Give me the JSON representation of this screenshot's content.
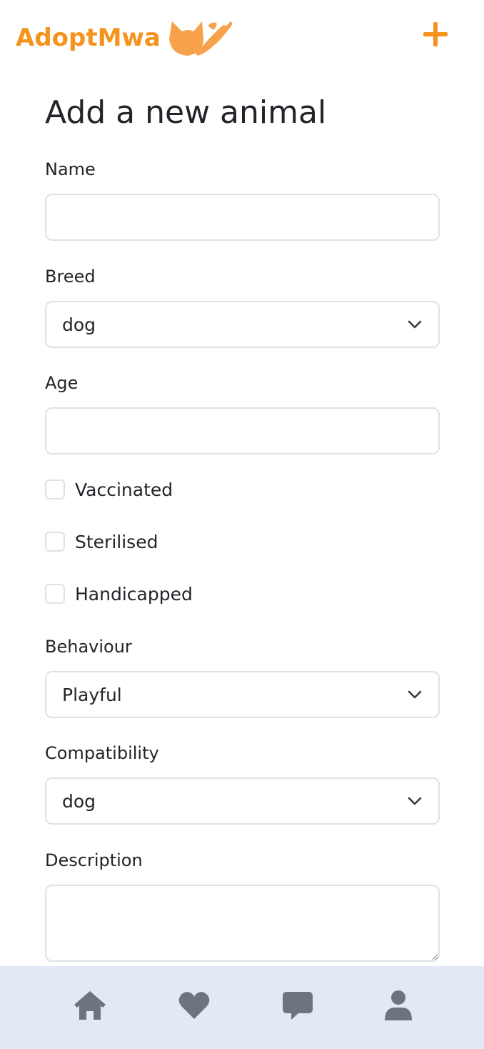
{
  "app": {
    "brand": "AdoptMwa",
    "colors": {
      "brand": "#f5941d",
      "nav_background": "#e2e9f4",
      "nav_icon": "#6c757d",
      "border": "#dee2e6"
    }
  },
  "header": {
    "add_icon": "plus-icon"
  },
  "form": {
    "title": "Add a new animal",
    "name": {
      "label": "Name",
      "value": "",
      "placeholder": ""
    },
    "breed": {
      "label": "Breed",
      "value": "dog"
    },
    "age": {
      "label": "Age",
      "value": "",
      "placeholder": ""
    },
    "checkboxes": [
      {
        "label": "Vaccinated",
        "checked": false
      },
      {
        "label": "Sterilised",
        "checked": false
      },
      {
        "label": "Handicapped",
        "checked": false
      }
    ],
    "behaviour": {
      "label": "Behaviour",
      "value": "Playful"
    },
    "compatibility": {
      "label": "Compatibility",
      "value": "dog"
    },
    "description": {
      "label": "Description",
      "value": ""
    }
  },
  "bottom_nav": {
    "items": [
      {
        "icon": "home-icon"
      },
      {
        "icon": "heart-icon"
      },
      {
        "icon": "chat-icon"
      },
      {
        "icon": "user-icon"
      }
    ]
  }
}
